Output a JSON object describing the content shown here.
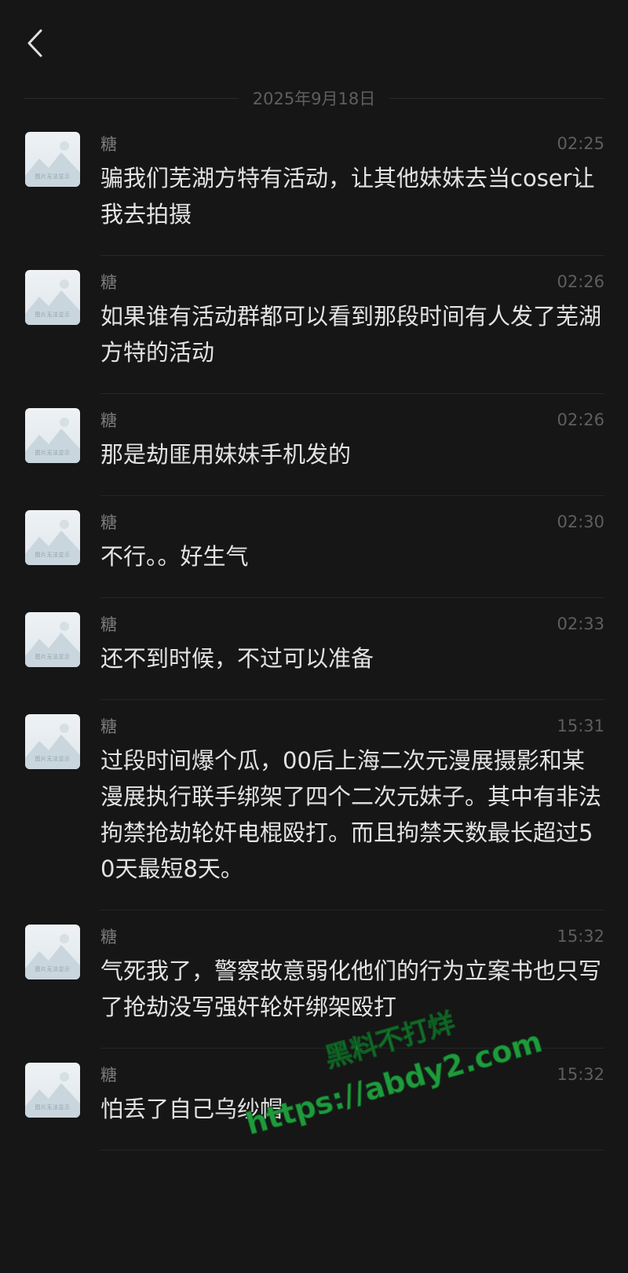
{
  "header": {
    "back_icon": "chevron-left-icon"
  },
  "date_separator": "2025年9月18日",
  "avatar_caption": "图片无法显示",
  "messages": [
    {
      "sender": "糖",
      "time": "02:25",
      "text": "骗我们芜湖方特有活动，让其他妹妹去当coser让我去拍摄"
    },
    {
      "sender": "糖",
      "time": "02:26",
      "text": "如果谁有活动群都可以看到那段时间有人发了芜湖方特的活动"
    },
    {
      "sender": "糖",
      "time": "02:26",
      "text": "那是劫匪用妹妹手机发的"
    },
    {
      "sender": "糖",
      "time": "02:30",
      "text": "不行。。好生气"
    },
    {
      "sender": "糖",
      "time": "02:33",
      "text": "还不到时候，不过可以准备"
    },
    {
      "sender": "糖",
      "time": "15:31",
      "text": "过段时间爆个瓜，00后上海二次元漫展摄影和某漫展执行联手绑架了四个二次元妹子。其中有非法拘禁抢劫轮奸电棍殴打。而且拘禁天数最长超过50天最短8天。"
    },
    {
      "sender": "糖",
      "time": "15:32",
      "text": "气死我了，警察故意弱化他们的行为立案书也只写了抢劫没写强奸轮奸绑架殴打"
    },
    {
      "sender": "糖",
      "time": "15:32",
      "text": "怕丢了自己乌纱帽"
    }
  ],
  "watermark": {
    "line1": "黑料不打烊",
    "line2": "https://abdy2.com",
    "color": "#1f9a3c"
  }
}
